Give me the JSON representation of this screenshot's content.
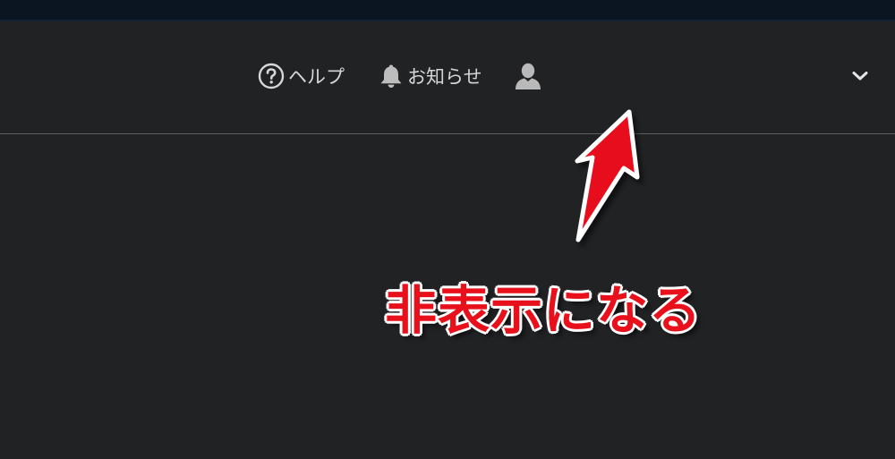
{
  "header": {
    "nav": {
      "help_label": "ヘルプ",
      "notifications_label": "お知らせ"
    }
  },
  "annotation": {
    "text": "非表示になる",
    "color": "#e8101a"
  },
  "colors": {
    "background": "#212224",
    "top_strip": "#0b1522",
    "nav_text": "#d6d6d6",
    "divider": "#5c5e62"
  },
  "icons": {
    "help": "question-circle-icon",
    "notifications": "bell-icon",
    "user": "user-icon",
    "menu": "chevron-down-icon"
  }
}
